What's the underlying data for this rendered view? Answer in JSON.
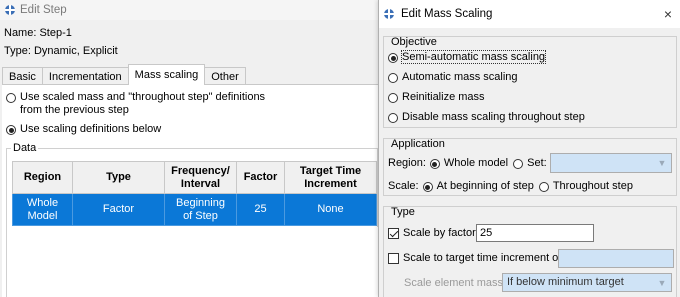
{
  "edit_step": {
    "window_title": "Edit Step",
    "name_label": "Name:",
    "name_value": "Step-1",
    "type_label": "Type:",
    "type_value": "Dynamic, Explicit",
    "tabs": [
      {
        "label": "Basic",
        "active": false
      },
      {
        "label": "Incrementation",
        "active": false
      },
      {
        "label": "Mass scaling",
        "active": true
      },
      {
        "label": "Other",
        "active": false
      }
    ],
    "options": {
      "use_previous_line1": "Use scaled mass and \"throughout step\" definitions",
      "use_previous_line2": "from the previous step",
      "use_below": "Use scaling definitions below",
      "selected": "use_below"
    },
    "data_group_title": "Data",
    "table": {
      "headers": [
        [
          "Region"
        ],
        [
          "Type"
        ],
        [
          "Frequency/",
          "Interval"
        ],
        [
          "Factor"
        ],
        [
          "Target Time",
          "Increment"
        ]
      ],
      "rows": [
        {
          "region": [
            "Whole",
            "Model"
          ],
          "type": "Factor",
          "frequency": [
            "Beginning",
            "of Step"
          ],
          "factor": "25",
          "target": "None"
        }
      ]
    }
  },
  "mass_scaling": {
    "window_title": "Edit Mass Scaling",
    "close_label": "×",
    "objective": {
      "title": "Objective",
      "options": [
        {
          "label": "Semi-automatic mass scaling",
          "selected": true
        },
        {
          "label": "Automatic mass scaling",
          "selected": false
        },
        {
          "label": "Reinitialize mass",
          "selected": false
        },
        {
          "label": "Disable mass scaling throughout step",
          "selected": false
        }
      ]
    },
    "application": {
      "title": "Application",
      "region_label": "Region:",
      "region_whole": "Whole model",
      "region_set": "Set:",
      "scale_label": "Scale:",
      "scale_begin": "At beginning of step",
      "scale_throughout": "Throughout step"
    },
    "type": {
      "title": "Type",
      "scale_by_factor_label": "Scale by factor:",
      "scale_by_factor_checked": true,
      "factor_value": "25",
      "scale_to_target_label": "Scale to target time increment of:",
      "scale_to_target_checked": false,
      "target_value": "",
      "scale_element_mass_label": "Scale element mass:",
      "scale_element_mass_value": "If below minimum target"
    }
  },
  "colors": {
    "selection_blue": "#0b78d7",
    "disabled_field": "#cfe3f6",
    "dialog_bg": "#f0f0f0"
  }
}
